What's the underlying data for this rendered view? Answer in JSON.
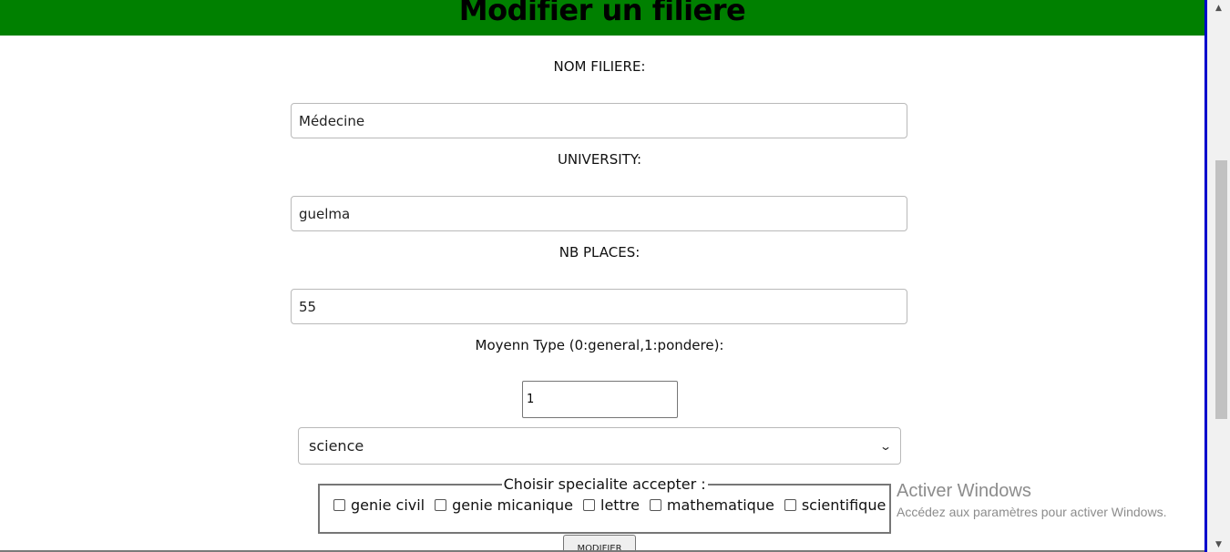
{
  "header": {
    "title": "Modifier un filiere"
  },
  "form": {
    "nom_filiere": {
      "label": "NOM FILIERE:",
      "value": "Médecine"
    },
    "university": {
      "label": "UNIVERSITY:",
      "value": "guelma"
    },
    "nb_places": {
      "label": "NB PLACES:",
      "value": "55"
    },
    "moyenne_type": {
      "label": "Moyenn Type (0:general,1:pondere):",
      "value": "1"
    },
    "bac_select": {
      "selected": "science"
    },
    "specialite": {
      "legend": "Choisir specialite accepter :",
      "options": [
        {
          "label": "genie civil",
          "checked": false
        },
        {
          "label": "genie micanique",
          "checked": false
        },
        {
          "label": "lettre",
          "checked": false
        },
        {
          "label": "mathematique",
          "checked": false
        },
        {
          "label": "scientifique",
          "checked": false
        }
      ]
    },
    "submit_label": "MODIFIER"
  },
  "watermark": {
    "title": "Activer Windows",
    "subtitle": "Accédez aux paramètres pour activer Windows."
  },
  "icons": {
    "select": "chevron-down-icon",
    "scroll_up": "scroll-up-arrow-icon",
    "scroll_down": "scroll-down-arrow-icon"
  },
  "colors": {
    "header_bg": "#008000",
    "window_edge": "#0000cc"
  }
}
